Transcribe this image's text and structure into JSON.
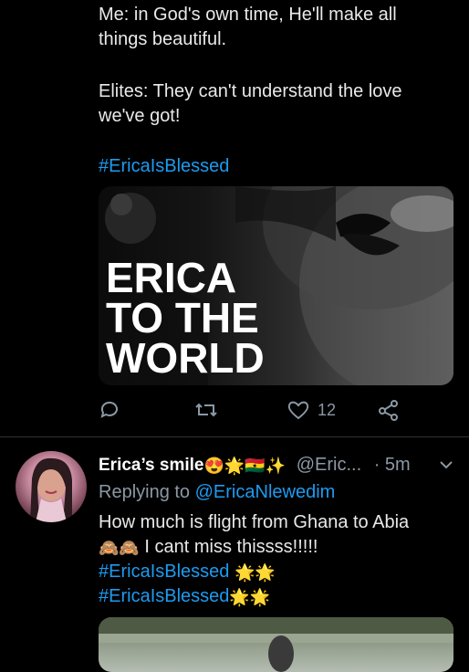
{
  "tweet1": {
    "line1": "Me: in God's own time, He'll make all",
    "line2": "things beautiful.",
    "line3": "Elites: They can't understand the love",
    "line4": "we've got!",
    "hashtag": "#EricaIsBlessed",
    "media": {
      "text_line1": "ERICA",
      "text_line2": "TO THE",
      "text_line3": "WORLD"
    },
    "actions": {
      "reply_icon": "reply-icon",
      "retweet_icon": "retweet-icon",
      "like_icon": "heart-icon",
      "like_count": "12",
      "share_icon": "share-icon"
    }
  },
  "tweet2": {
    "display_name": "Erica’s smile",
    "name_emojis": "😍🌟🇬🇭✨",
    "handle": "@Eric...",
    "time": "· 5m",
    "replying_prefix": "Replying to",
    "replying_to": "@EricaNlewedim",
    "text_line1": "How much is flight from Ghana to Abia",
    "text_line2_emojis": "🙈🙈",
    "text_line2": "I cant miss thissss!!!!!",
    "hashtag_line1": "#EricaIsBlessed",
    "hashtag_line1_emojis": "🌟🌟",
    "hashtag_line2": "#EricaIsBlessed",
    "hashtag_line2_emojis": "🌟🌟"
  },
  "colors": {
    "background": "#000000",
    "text": "#e9e9e9",
    "link": "#1d9bf0",
    "muted": "#8b98a5"
  }
}
